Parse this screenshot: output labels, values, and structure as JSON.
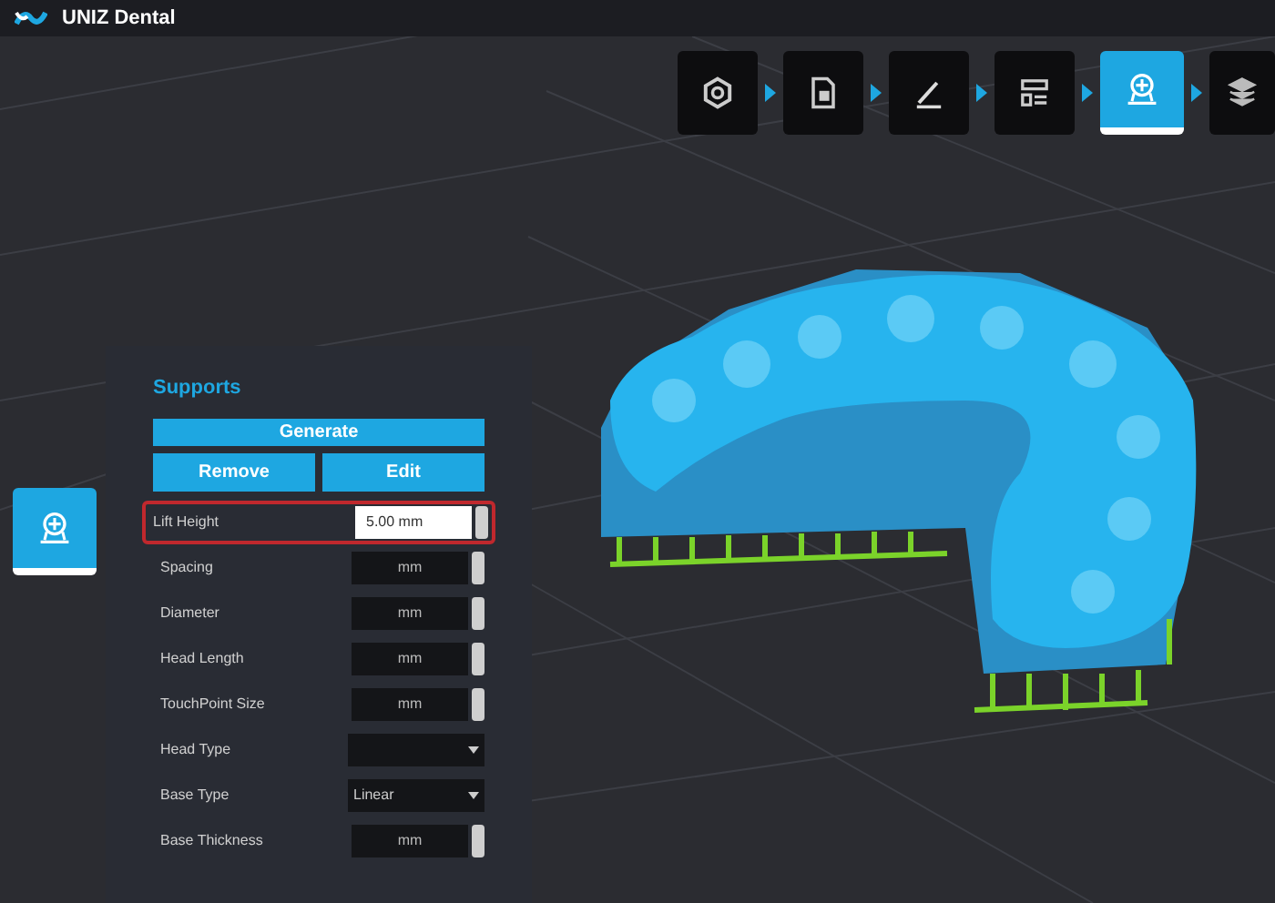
{
  "window": {
    "title": "UNIZ Dental"
  },
  "steps": [
    {
      "kind": "gear",
      "selected": false
    },
    {
      "kind": "document",
      "selected": false
    },
    {
      "kind": "pen",
      "selected": false
    },
    {
      "kind": "list",
      "selected": false
    },
    {
      "kind": "supports",
      "selected": true
    },
    {
      "kind": "layers",
      "selected": false
    }
  ],
  "side_tool": {
    "kind": "supports",
    "selected": true
  },
  "panel": {
    "title": "Supports",
    "buttons": [
      "Generate",
      "Remove",
      "Edit"
    ],
    "rows": [
      {
        "label": "Lift Height",
        "kind": "spinner",
        "value": "5.00 mm",
        "highlighted": true
      },
      {
        "label": "Spacing",
        "kind": "spinner",
        "value": "mm",
        "highlighted": false
      },
      {
        "label": "Diameter",
        "kind": "spinner",
        "value": "mm",
        "highlighted": false
      },
      {
        "label": "Head Length",
        "kind": "spinner",
        "value": "mm",
        "highlighted": false
      },
      {
        "label": "TouchPoint Size",
        "kind": "spinner",
        "value": "mm",
        "highlighted": false
      },
      {
        "label": "Head Type",
        "kind": "dropdown",
        "highlighted": false
      },
      {
        "label": "Base Type",
        "kind": "dropdown",
        "value": "Linear",
        "highlighted": false
      },
      {
        "label": "Base Thickness",
        "kind": "spinner",
        "value": "mm",
        "highlighted": false
      }
    ]
  }
}
